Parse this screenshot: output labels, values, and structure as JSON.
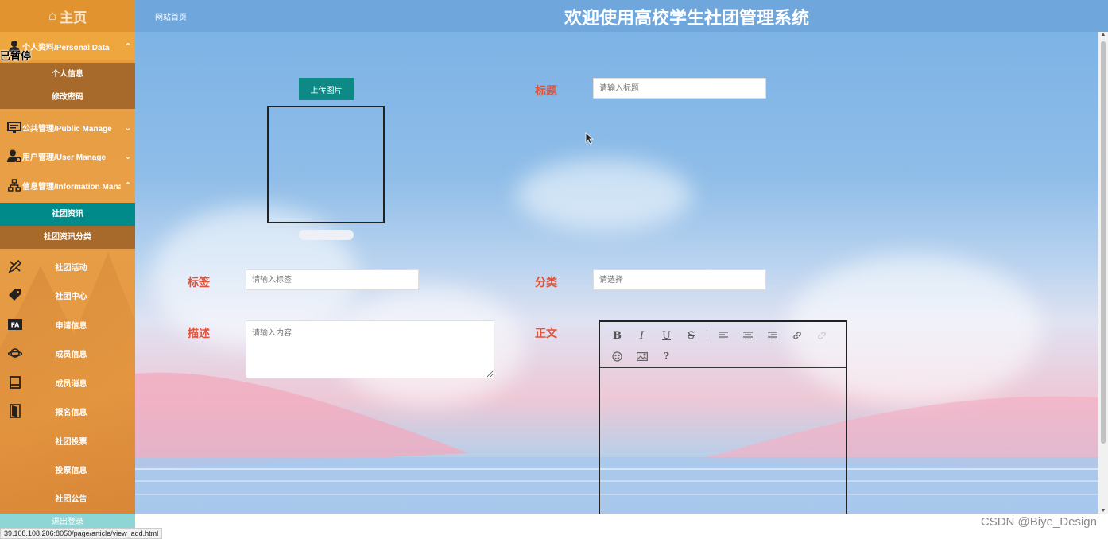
{
  "sidebar": {
    "home_title": "主页",
    "paused_overlay": "已暂停",
    "personal_data": {
      "label": "个人资料/Personal Data",
      "sub": [
        "个人信息",
        "修改密码"
      ]
    },
    "public_manage": {
      "label": "公共管理/Public Manage"
    },
    "user_manage": {
      "label": "用户管理/User Manage"
    },
    "info_manage": {
      "label": "信息管理/Information Manage",
      "sub": [
        "社团资讯",
        "社团资讯分类"
      ]
    },
    "items": [
      "社团活动",
      "社团中心",
      "申请信息",
      "成员信息",
      "成员消息",
      "报名信息",
      "社团投票",
      "投票信息",
      "社团公告"
    ],
    "logout": "退出登录"
  },
  "header": {
    "home_link": "网站首页",
    "title": "欢迎使用高校学生社团管理系统"
  },
  "form": {
    "upload_label": "上传图片",
    "title_label": "标题",
    "title_placeholder": "请输入标题",
    "tags_label": "标签",
    "tags_placeholder": "请输入标签",
    "category_label": "分类",
    "category_placeholder": "请选择",
    "desc_label": "描述",
    "desc_placeholder": "请输入内容",
    "body_label": "正文",
    "editor_help": "?"
  },
  "status_url": "39.108.108.206:8050/page/article/view_add.html",
  "watermark": "CSDN @Biye_Design",
  "colors": {
    "sidebar": "#e89a3a",
    "submenu": "#a86a2a",
    "active": "#008a8a",
    "header": "#6fa6dc",
    "label": "#e0533a",
    "button": "#0e8a86"
  }
}
